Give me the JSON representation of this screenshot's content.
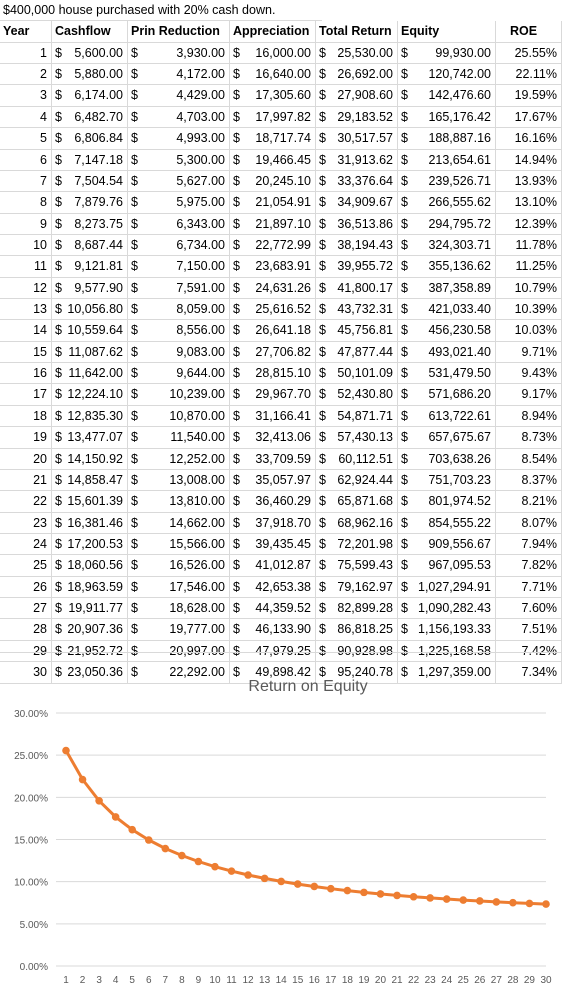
{
  "sheet": {
    "title": "$400,000 house purchased with 20% cash down.",
    "headers": {
      "year": "Year",
      "cashflow": "Cashflow",
      "prin": "Prin Reduction",
      "appreciation": "Appreciation",
      "total": "Total Return",
      "equity": "Equity",
      "roe": "ROE"
    },
    "rows": [
      {
        "year": "1",
        "cashflow": "5,600.00",
        "prin": "3,930.00",
        "appreciation": "16,000.00",
        "total": "25,530.00",
        "equity": "99,930.00",
        "roe": "25.55%"
      },
      {
        "year": "2",
        "cashflow": "5,880.00",
        "prin": "4,172.00",
        "appreciation": "16,640.00",
        "total": "26,692.00",
        "equity": "120,742.00",
        "roe": "22.11%"
      },
      {
        "year": "3",
        "cashflow": "6,174.00",
        "prin": "4,429.00",
        "appreciation": "17,305.60",
        "total": "27,908.60",
        "equity": "142,476.60",
        "roe": "19.59%"
      },
      {
        "year": "4",
        "cashflow": "6,482.70",
        "prin": "4,703.00",
        "appreciation": "17,997.82",
        "total": "29,183.52",
        "equity": "165,176.42",
        "roe": "17.67%"
      },
      {
        "year": "5",
        "cashflow": "6,806.84",
        "prin": "4,993.00",
        "appreciation": "18,717.74",
        "total": "30,517.57",
        "equity": "188,887.16",
        "roe": "16.16%"
      },
      {
        "year": "6",
        "cashflow": "7,147.18",
        "prin": "5,300.00",
        "appreciation": "19,466.45",
        "total": "31,913.62",
        "equity": "213,654.61",
        "roe": "14.94%"
      },
      {
        "year": "7",
        "cashflow": "7,504.54",
        "prin": "5,627.00",
        "appreciation": "20,245.10",
        "total": "33,376.64",
        "equity": "239,526.71",
        "roe": "13.93%"
      },
      {
        "year": "8",
        "cashflow": "7,879.76",
        "prin": "5,975.00",
        "appreciation": "21,054.91",
        "total": "34,909.67",
        "equity": "266,555.62",
        "roe": "13.10%"
      },
      {
        "year": "9",
        "cashflow": "8,273.75",
        "prin": "6,343.00",
        "appreciation": "21,897.10",
        "total": "36,513.86",
        "equity": "294,795.72",
        "roe": "12.39%"
      },
      {
        "year": "10",
        "cashflow": "8,687.44",
        "prin": "6,734.00",
        "appreciation": "22,772.99",
        "total": "38,194.43",
        "equity": "324,303.71",
        "roe": "11.78%"
      },
      {
        "year": "11",
        "cashflow": "9,121.81",
        "prin": "7,150.00",
        "appreciation": "23,683.91",
        "total": "39,955.72",
        "equity": "355,136.62",
        "roe": "11.25%"
      },
      {
        "year": "12",
        "cashflow": "9,577.90",
        "prin": "7,591.00",
        "appreciation": "24,631.26",
        "total": "41,800.17",
        "equity": "387,358.89",
        "roe": "10.79%"
      },
      {
        "year": "13",
        "cashflow": "10,056.80",
        "prin": "8,059.00",
        "appreciation": "25,616.52",
        "total": "43,732.31",
        "equity": "421,033.40",
        "roe": "10.39%"
      },
      {
        "year": "14",
        "cashflow": "10,559.64",
        "prin": "8,556.00",
        "appreciation": "26,641.18",
        "total": "45,756.81",
        "equity": "456,230.58",
        "roe": "10.03%"
      },
      {
        "year": "15",
        "cashflow": "11,087.62",
        "prin": "9,083.00",
        "appreciation": "27,706.82",
        "total": "47,877.44",
        "equity": "493,021.40",
        "roe": "9.71%"
      },
      {
        "year": "16",
        "cashflow": "11,642.00",
        "prin": "9,644.00",
        "appreciation": "28,815.10",
        "total": "50,101.09",
        "equity": "531,479.50",
        "roe": "9.43%"
      },
      {
        "year": "17",
        "cashflow": "12,224.10",
        "prin": "10,239.00",
        "appreciation": "29,967.70",
        "total": "52,430.80",
        "equity": "571,686.20",
        "roe": "9.17%"
      },
      {
        "year": "18",
        "cashflow": "12,835.30",
        "prin": "10,870.00",
        "appreciation": "31,166.41",
        "total": "54,871.71",
        "equity": "613,722.61",
        "roe": "8.94%"
      },
      {
        "year": "19",
        "cashflow": "13,477.07",
        "prin": "11,540.00",
        "appreciation": "32,413.06",
        "total": "57,430.13",
        "equity": "657,675.67",
        "roe": "8.73%"
      },
      {
        "year": "20",
        "cashflow": "14,150.92",
        "prin": "12,252.00",
        "appreciation": "33,709.59",
        "total": "60,112.51",
        "equity": "703,638.26",
        "roe": "8.54%"
      },
      {
        "year": "21",
        "cashflow": "14,858.47",
        "prin": "13,008.00",
        "appreciation": "35,057.97",
        "total": "62,924.44",
        "equity": "751,703.23",
        "roe": "8.37%"
      },
      {
        "year": "22",
        "cashflow": "15,601.39",
        "prin": "13,810.00",
        "appreciation": "36,460.29",
        "total": "65,871.68",
        "equity": "801,974.52",
        "roe": "8.21%"
      },
      {
        "year": "23",
        "cashflow": "16,381.46",
        "prin": "14,662.00",
        "appreciation": "37,918.70",
        "total": "68,962.16",
        "equity": "854,555.22",
        "roe": "8.07%"
      },
      {
        "year": "24",
        "cashflow": "17,200.53",
        "prin": "15,566.00",
        "appreciation": "39,435.45",
        "total": "72,201.98",
        "equity": "909,556.67",
        "roe": "7.94%"
      },
      {
        "year": "25",
        "cashflow": "18,060.56",
        "prin": "16,526.00",
        "appreciation": "41,012.87",
        "total": "75,599.43",
        "equity": "967,095.53",
        "roe": "7.82%"
      },
      {
        "year": "26",
        "cashflow": "18,963.59",
        "prin": "17,546.00",
        "appreciation": "42,653.38",
        "total": "79,162.97",
        "equity": "1,027,294.91",
        "roe": "7.71%"
      },
      {
        "year": "27",
        "cashflow": "19,911.77",
        "prin": "18,628.00",
        "appreciation": "44,359.52",
        "total": "82,899.28",
        "equity": "1,090,282.43",
        "roe": "7.60%"
      },
      {
        "year": "28",
        "cashflow": "20,907.36",
        "prin": "19,777.00",
        "appreciation": "46,133.90",
        "total": "86,818.25",
        "equity": "1,156,193.33",
        "roe": "7.51%"
      },
      {
        "year": "29",
        "cashflow": "21,952.72",
        "prin": "20,997.00",
        "appreciation": "47,979.25",
        "total": "90,928.98",
        "equity": "1,225,168.58",
        "roe": "7.42%"
      },
      {
        "year": "30",
        "cashflow": "23,050.36",
        "prin": "22,292.00",
        "appreciation": "49,898.42",
        "total": "95,240.78",
        "equity": "1,297,359.00",
        "roe": "7.34%"
      }
    ]
  },
  "chart_data": {
    "type": "line",
    "title": "Return on Equity",
    "xlabel": "",
    "ylabel": "",
    "x": [
      1,
      2,
      3,
      4,
      5,
      6,
      7,
      8,
      9,
      10,
      11,
      12,
      13,
      14,
      15,
      16,
      17,
      18,
      19,
      20,
      21,
      22,
      23,
      24,
      25,
      26,
      27,
      28,
      29,
      30
    ],
    "series": [
      {
        "values": [
          25.55,
          22.11,
          19.59,
          17.67,
          16.16,
          14.94,
          13.93,
          13.1,
          12.39,
          11.78,
          11.25,
          10.79,
          10.39,
          10.03,
          9.71,
          9.43,
          9.17,
          8.94,
          8.73,
          8.54,
          8.37,
          8.21,
          8.07,
          7.94,
          7.82,
          7.71,
          7.6,
          7.51,
          7.42,
          7.34
        ]
      }
    ],
    "ylim": [
      0,
      30
    ],
    "y_ticks": [
      "0.00%",
      "5.00%",
      "10.00%",
      "15.00%",
      "20.00%",
      "25.00%",
      "30.00%"
    ],
    "grid": true,
    "legend": "none",
    "line_color": "#ED7D31",
    "grid_color": "#d9d9d9"
  }
}
